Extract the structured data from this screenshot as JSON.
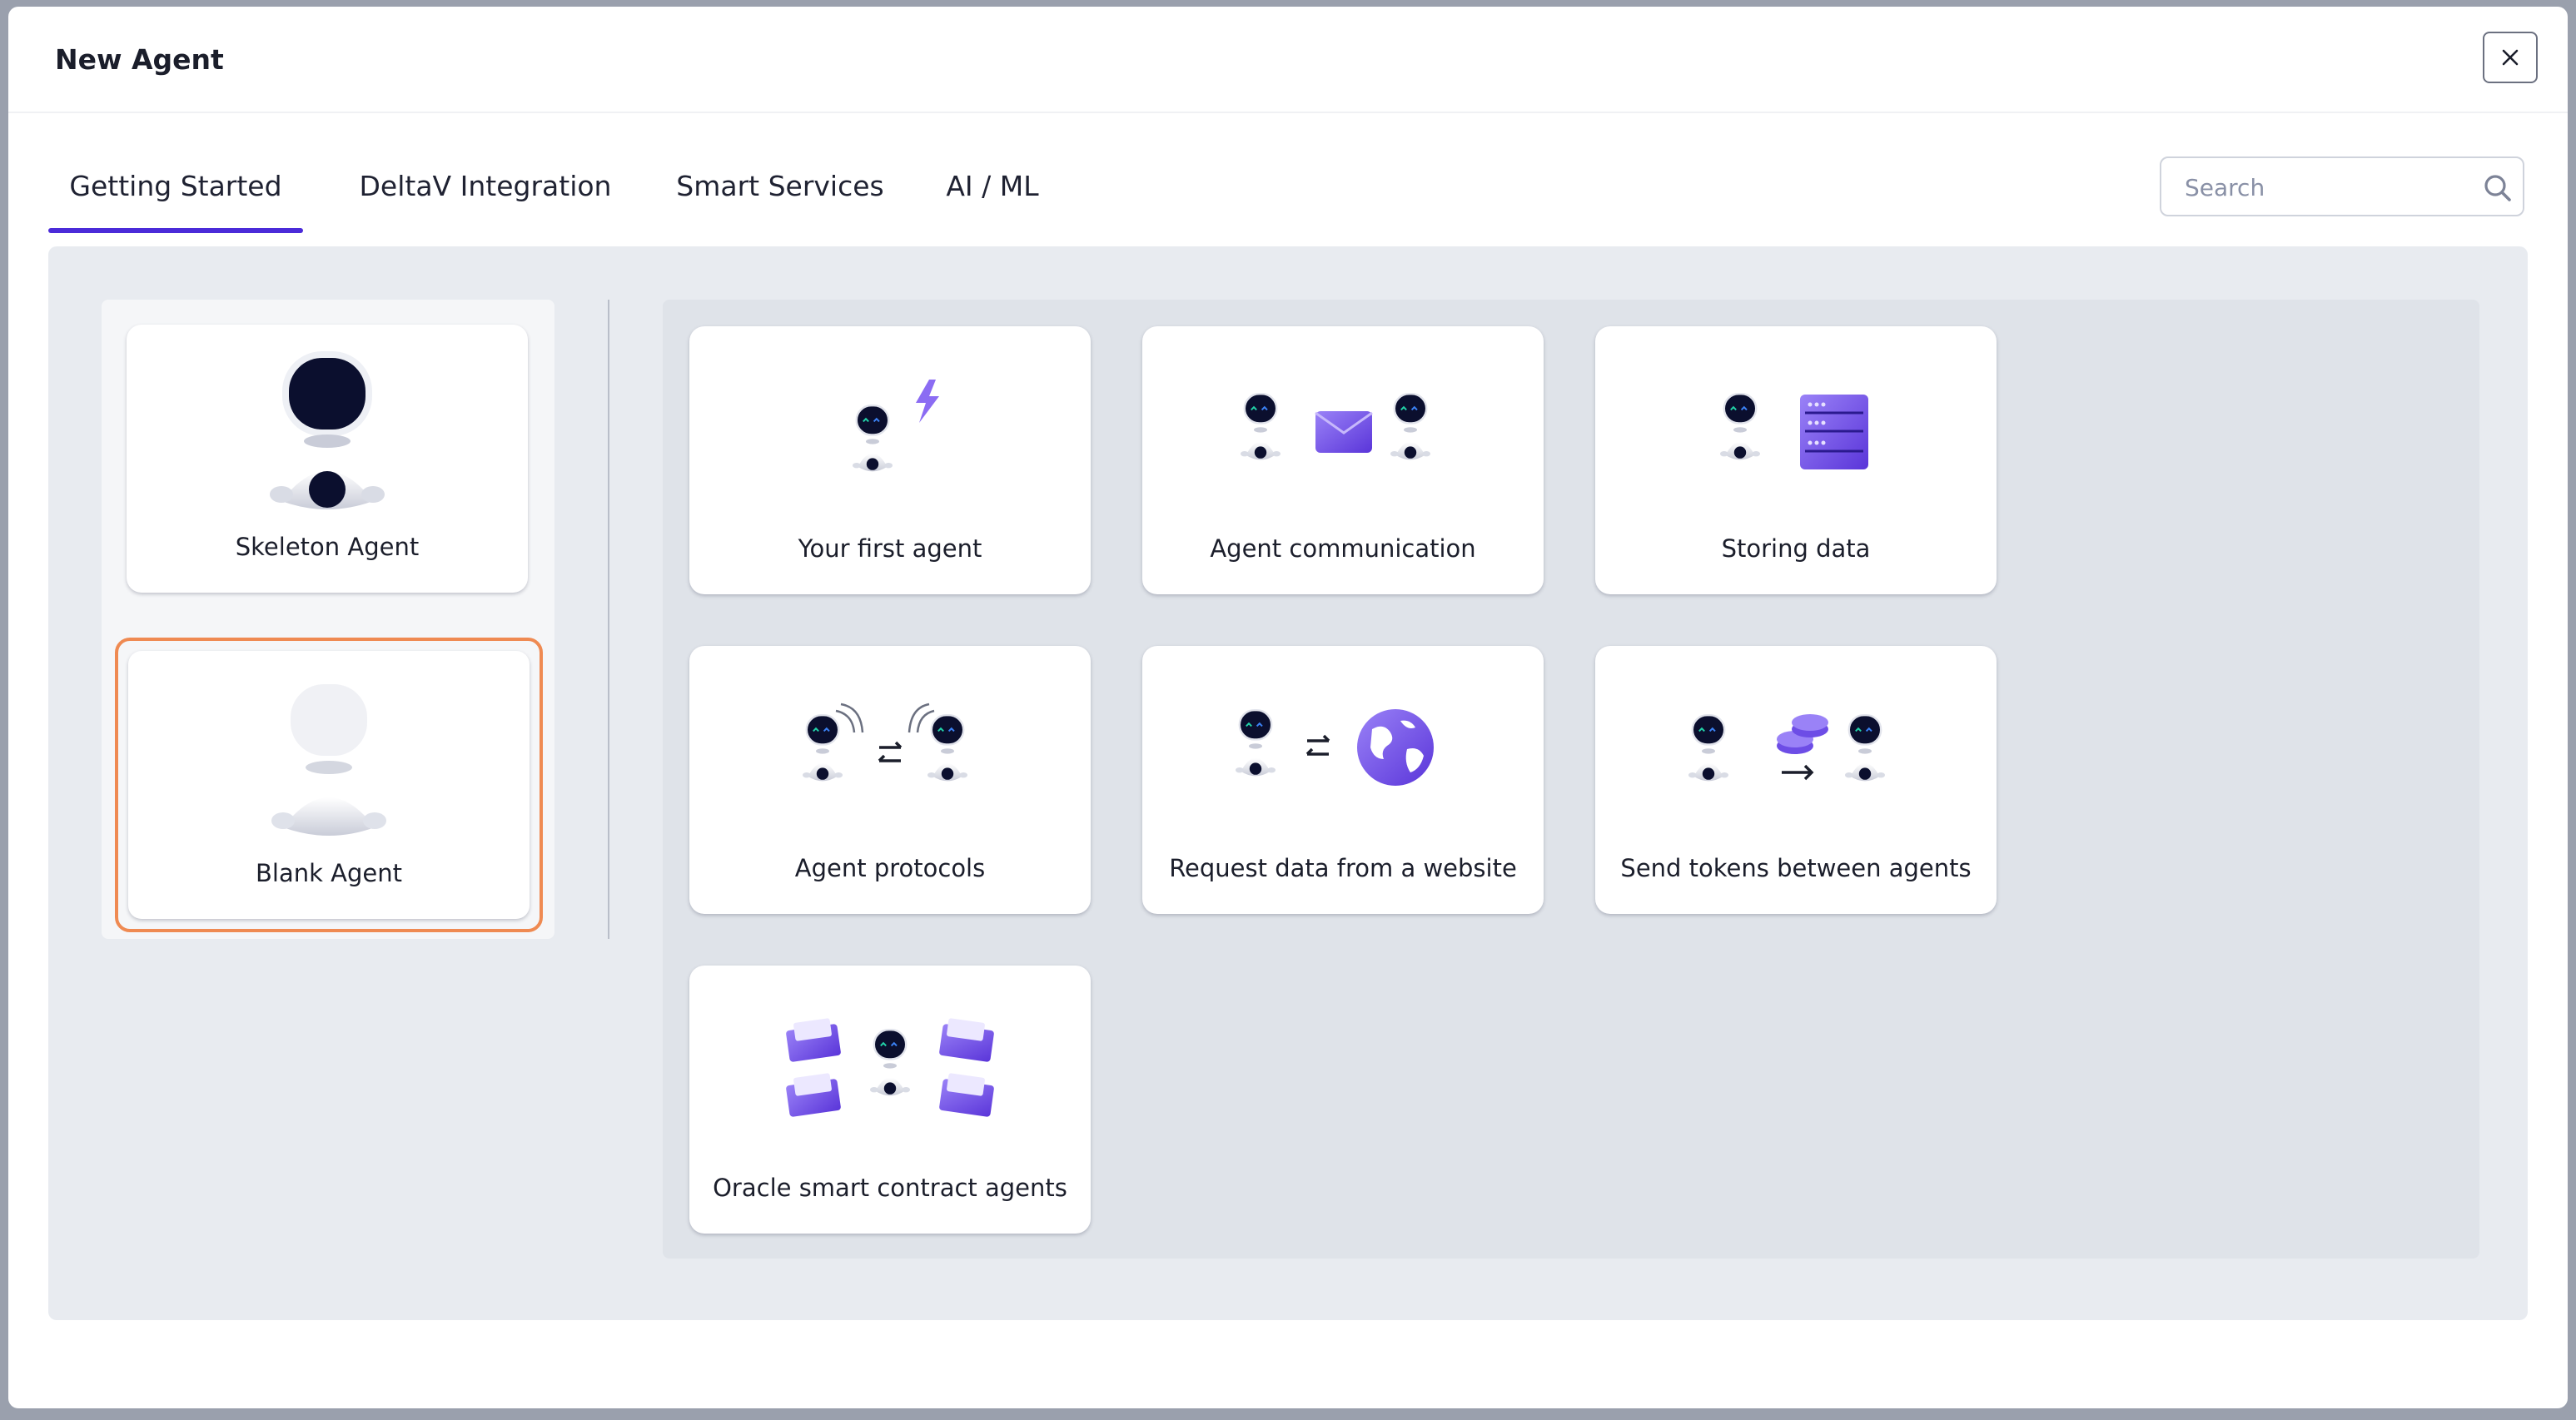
{
  "dialog": {
    "title": "New Agent",
    "close_icon": "close-icon"
  },
  "tabs": [
    {
      "label": "Getting Started",
      "active": true
    },
    {
      "label": "DeltaV Integration",
      "active": false
    },
    {
      "label": "Smart Services",
      "active": false
    },
    {
      "label": "AI / ML",
      "active": false
    }
  ],
  "search": {
    "placeholder": "Search",
    "value": "",
    "icon": "search-icon"
  },
  "base_templates": [
    {
      "label": "Skeleton Agent",
      "icon": "skeleton-agent-icon",
      "selected": false
    },
    {
      "label": "Blank Agent",
      "icon": "blank-agent-icon",
      "selected": true
    }
  ],
  "templates": [
    {
      "label": "Your first agent",
      "icon": "first-agent-icon"
    },
    {
      "label": "Agent communication",
      "icon": "agent-communication-icon"
    },
    {
      "label": "Storing data",
      "icon": "storing-data-icon"
    },
    {
      "label": "Agent protocols",
      "icon": "agent-protocols-icon"
    },
    {
      "label": "Request data from a website",
      "icon": "request-web-data-icon"
    },
    {
      "label": "Send tokens between agents",
      "icon": "send-tokens-icon"
    },
    {
      "label": "Oracle smart contract agents",
      "icon": "oracle-contract-icon"
    }
  ],
  "colors": {
    "accent": "#4b2bd9",
    "selection": "#ef8a52",
    "purple": "#7d5cf0",
    "robot_face": "#0b0f2e"
  }
}
